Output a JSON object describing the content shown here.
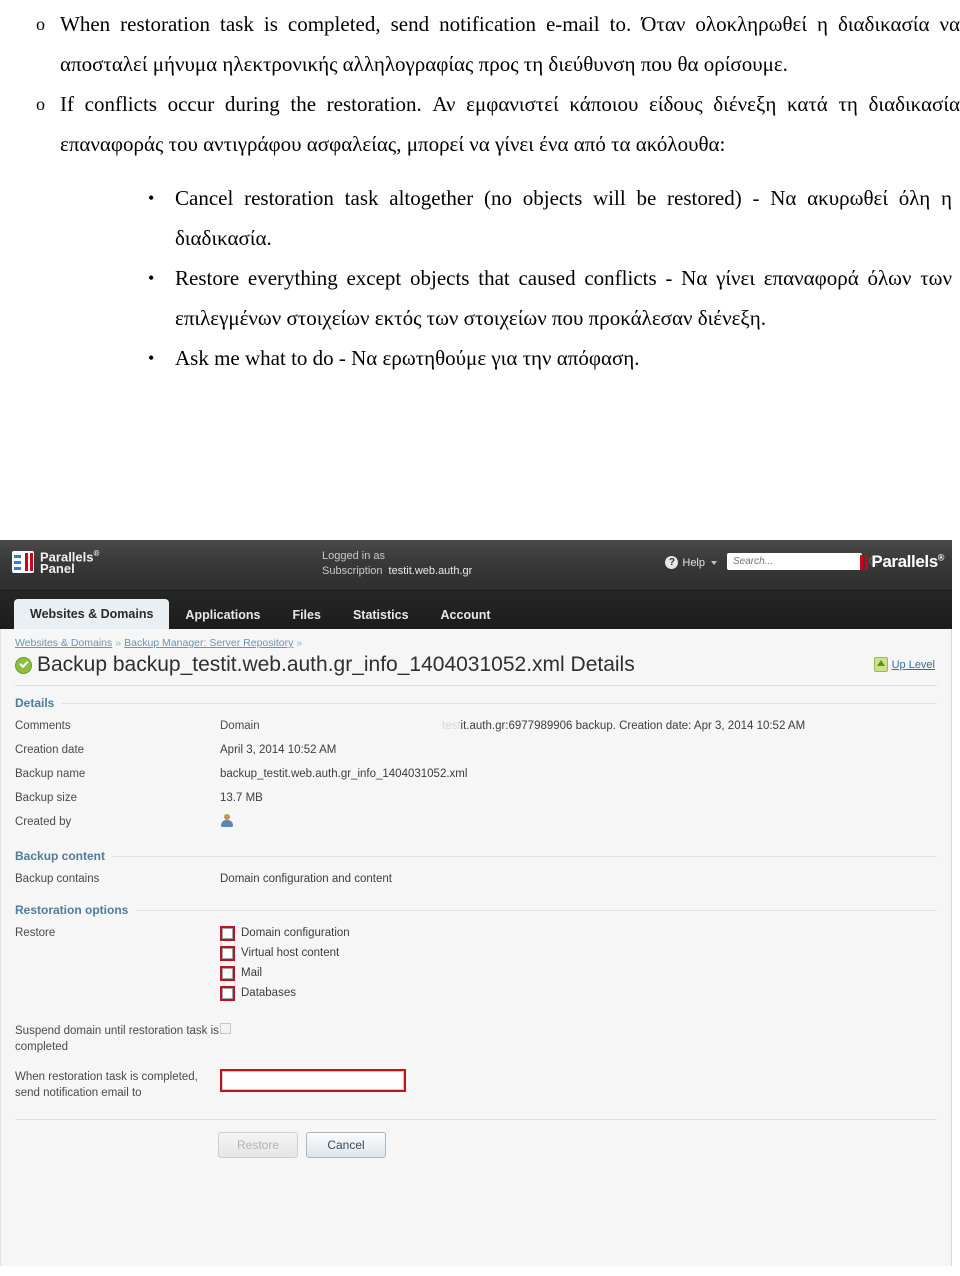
{
  "document": {
    "bullets_level1": [
      {
        "marker": "o",
        "text": "When restoration task is completed, send notification e-mail to. Όταν ολοκληρωθεί η διαδικασία να αποσταλεί μήνυμα ηλεκτρονικής αλληλογραφίας προς τη διεύθυνση που θα ορίσουμε."
      },
      {
        "marker": "o",
        "text": "If conflicts occur during the restoration. Αν εμφανιστεί κάποιου είδους διένεξη κατά τη διαδικασία επαναφοράς του αντιγράφου ασφαλείας, μπορεί να γίνει ένα από τα ακόλουθα:"
      }
    ],
    "bullets_level2": [
      {
        "marker": "•",
        "text": "Cancel restoration task altogether (no objects will be restored) - Να ακυρωθεί όλη η διαδικασία."
      },
      {
        "marker": "•",
        "text": "Restore everything except objects that caused conflicts - Να γίνει επαναφορά όλων των επιλεγμένων στοιχείων εκτός των στοιχείων που προκάλεσαν διένεξη."
      },
      {
        "marker": "•",
        "text": "Ask me what to do - Να ερωτηθούμε για την απόφαση."
      }
    ]
  },
  "app": {
    "header": {
      "brand_line1": "Parallels",
      "brand_sup": "®",
      "brand_line2": "Panel",
      "logged_in_as": "Logged in as",
      "subscription_label": "Subscription",
      "subscription_value": "testit.web.auth.gr",
      "help_label": "Help",
      "help_icon": "question-mark-icon",
      "search_placeholder": "Search...",
      "search_value": "",
      "search_icon": "magnifier-icon",
      "corp_logo_text": "Parallels",
      "corp_logo_sup": "®"
    },
    "tabs": [
      {
        "label": "Websites & Domains",
        "active": true
      },
      {
        "label": "Applications",
        "active": false
      },
      {
        "label": "Files",
        "active": false
      },
      {
        "label": "Statistics",
        "active": false
      },
      {
        "label": "Account",
        "active": false
      }
    ],
    "breadcrumb": {
      "item1": "Websites & Domains",
      "sep1": "»",
      "item2": "Backup Manager: Server Repository",
      "sep2": "»"
    },
    "page": {
      "title": "Backup backup_testit.web.auth.gr_info_1404031052.xml Details",
      "title_icon": "green-check-circle-icon",
      "up_level_label": "Up Level",
      "up_level_icon": "up-arrow-icon"
    },
    "sections": {
      "details": {
        "header": "Details",
        "rows": [
          {
            "label": "Comments",
            "value_sub": "Domain",
            "value_faded": "test",
            "value_main": "it.auth.gr:6977989906 backup. Creation date: Apr 3, 2014 10:52 AM"
          },
          {
            "label": "Creation date",
            "value": "April 3, 2014 10:52 AM"
          },
          {
            "label": "Backup name",
            "value": "backup_testit.web.auth.gr_info_1404031052.xml"
          },
          {
            "label": "Backup size",
            "value": "13.7 MB"
          },
          {
            "label": "Created by",
            "value": "",
            "icon": "user-avatar-icon"
          }
        ]
      },
      "backup_content": {
        "header": "Backup content",
        "rows": [
          {
            "label": "Backup contains",
            "value": "Domain configuration and content"
          }
        ]
      },
      "restoration_options": {
        "header": "Restoration options",
        "restore_label": "Restore",
        "checkboxes": [
          {
            "label": "Domain configuration",
            "checked": false,
            "highlighted": true
          },
          {
            "label": "Virtual host content",
            "checked": false,
            "highlighted": true
          },
          {
            "label": "Mail",
            "checked": false,
            "highlighted": true
          },
          {
            "label": "Databases",
            "checked": false,
            "highlighted": true
          }
        ],
        "suspend_label": "Suspend domain until restoration task is completed",
        "suspend_checked": false,
        "email_label": "When restoration task is completed, send notification email to",
        "email_value": "",
        "email_highlighted": true
      }
    },
    "buttons": {
      "restore": "Restore",
      "restore_disabled": true,
      "cancel": "Cancel",
      "cancel_disabled": false
    }
  },
  "colors": {
    "highlight_red": "#c0121b",
    "section_blue": "#4f7c99",
    "link_blue": "#3a6f9f",
    "brand_red": "#d0021b"
  }
}
